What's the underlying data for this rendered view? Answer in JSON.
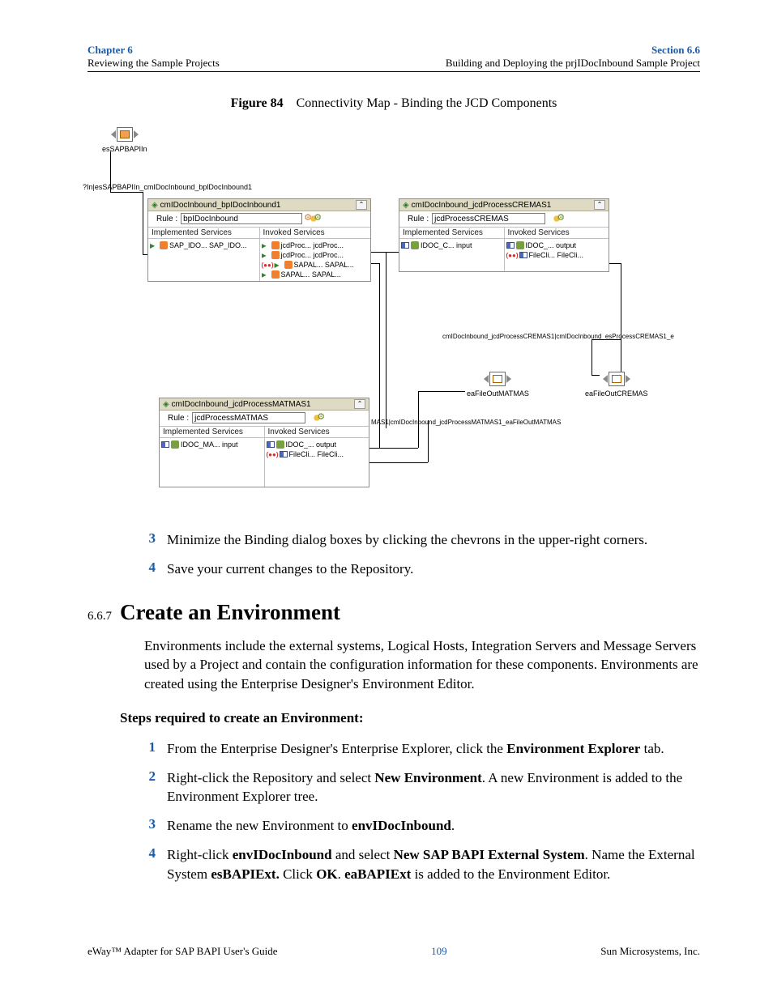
{
  "header": {
    "left_title": "Chapter 6",
    "left_sub": "Reviewing the Sample Projects",
    "right_title": "Section 6.6",
    "right_sub": "Building and Deploying the prjIDocInbound Sample Project"
  },
  "figure": {
    "label": "Figure 84",
    "caption": "Connectivity Map - Binding the JCD Components"
  },
  "canvas": {
    "es_sap": "esSAPBAPIIn",
    "conn1": "?In|esSAPBAPIIn_cmIDocInbound_bplDocInbound1",
    "conn2": "cmIDocInbound_jcdProcessCREMAS1|cmIDocInbound_esProcessCREMAS1_e",
    "conn3": "MAS1|cmIDocInbound_jcdProcessMATMAS1_eaFileOutMATMAS",
    "efile_cremas": "eaFileOutCREMAS",
    "efile_matmas": "eaFileOutMATMAS"
  },
  "box1": {
    "title": "cmIDocInbound_bpIDocInbound1",
    "rule_label": "Rule :",
    "rule_value": "bpIDocInbound",
    "imp_h": "Implemented Services",
    "inv_h": "Invoked Services",
    "imp_items": [
      "SAP_IDO... SAP_IDO..."
    ],
    "inv_items": [
      "jcdProc... jcdProc...",
      "jcdProc... jcdProc...",
      "SAPAL... SAPAL...",
      "SAPAL... SAPAL..."
    ]
  },
  "box2": {
    "title": "cmIDocInbound_jcdProcessCREMAS1",
    "rule_label": "Rule :",
    "rule_value": "jcdProcessCREMAS",
    "imp_h": "Implemented Services",
    "inv_h": "Invoked Services",
    "imp_items": [
      "IDOC_C... input"
    ],
    "inv_items": [
      "IDOC_... output",
      "FileCli... FileCli..."
    ]
  },
  "box3": {
    "title": "cmIDocInbound_jcdProcessMATMAS1",
    "rule_label": "Rule :",
    "rule_value": "jcdProcessMATMAS",
    "imp_h": "Implemented Services",
    "inv_h": "Invoked Services",
    "imp_items": [
      "IDOC_MA... input"
    ],
    "inv_items": [
      "IDOC_... output",
      "FileCli... FileCli..."
    ]
  },
  "steps_a": {
    "s3": "Minimize the Binding dialog boxes by clicking the chevrons in the upper-right corners.",
    "s4": "Save your current changes to the Repository."
  },
  "section": {
    "num": "6.6.7",
    "title": "Create an Environment",
    "intro": "Environments include the external systems, Logical Hosts, Integration Servers and Message Servers used by a Project and contain the configuration information for these components. Environments are created using the Enterprise Designer's Environment Editor.",
    "steps_label": "Steps required to create an Environment:"
  },
  "steps_b": {
    "s1_a": "From the Enterprise Designer's Enterprise Explorer, click the ",
    "s1_b": "Environment Explorer",
    "s1_c": " tab.",
    "s2_a": "Right-click the Repository and select ",
    "s2_b": "New Environment",
    "s2_c": ". A new Environment is added to the Environment Explorer tree.",
    "s3_a": "Rename the new Environment to ",
    "s3_b": "envIDocInbound",
    "s3_c": ".",
    "s4_a": "Right-click ",
    "s4_b": "envIDocInbound",
    "s4_c": " and select ",
    "s4_d": "New SAP BAPI External System",
    "s4_e": ". Name the External System ",
    "s4_f": "esBAPIExt.",
    "s4_g": " Click ",
    "s4_h": "OK",
    "s4_i": ". ",
    "s4_j": "eaBAPIExt",
    "s4_k": " is added to the Environment Editor."
  },
  "footer": {
    "left": "eWay™ Adapter for SAP BAPI User's Guide",
    "page": "109",
    "right": "Sun Microsystems, Inc."
  }
}
